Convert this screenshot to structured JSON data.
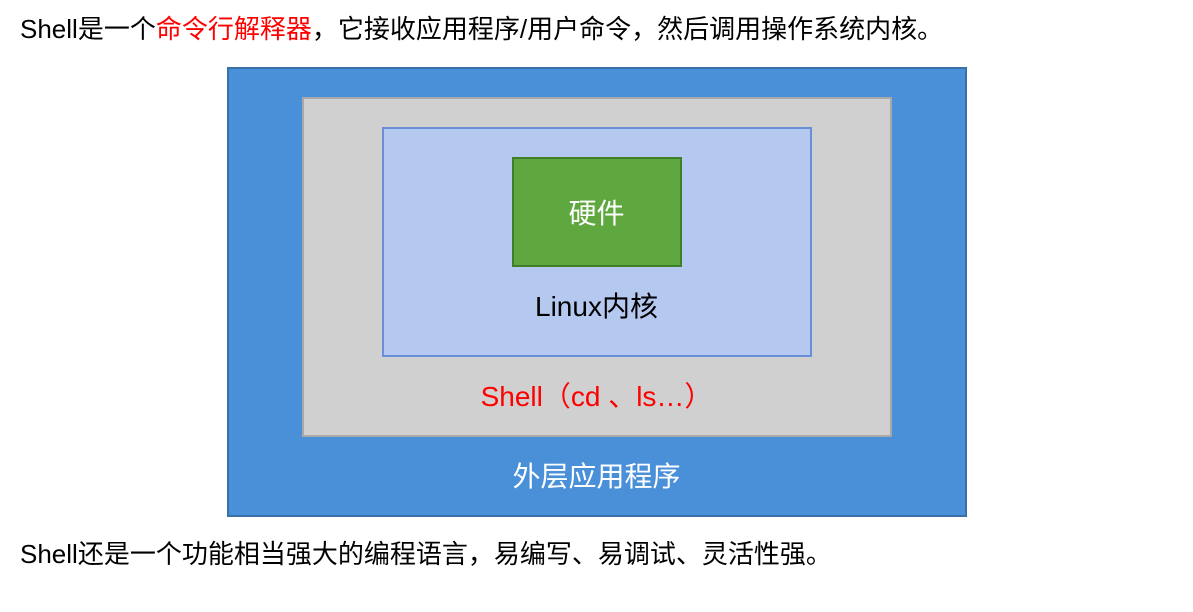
{
  "topText": {
    "prefix": "Shell是一个",
    "highlight": "命令行解释器",
    "suffix": "，它接收应用程序/用户命令，然后调用操作系统内核。"
  },
  "diagram": {
    "outer": "外层应用程序",
    "shell": "Shell（cd 、ls…）",
    "kernel": "Linux内核",
    "hardware": "硬件"
  },
  "bottomText": "Shell还是一个功能相当强大的编程语言，易编写、易调试、灵活性强。"
}
